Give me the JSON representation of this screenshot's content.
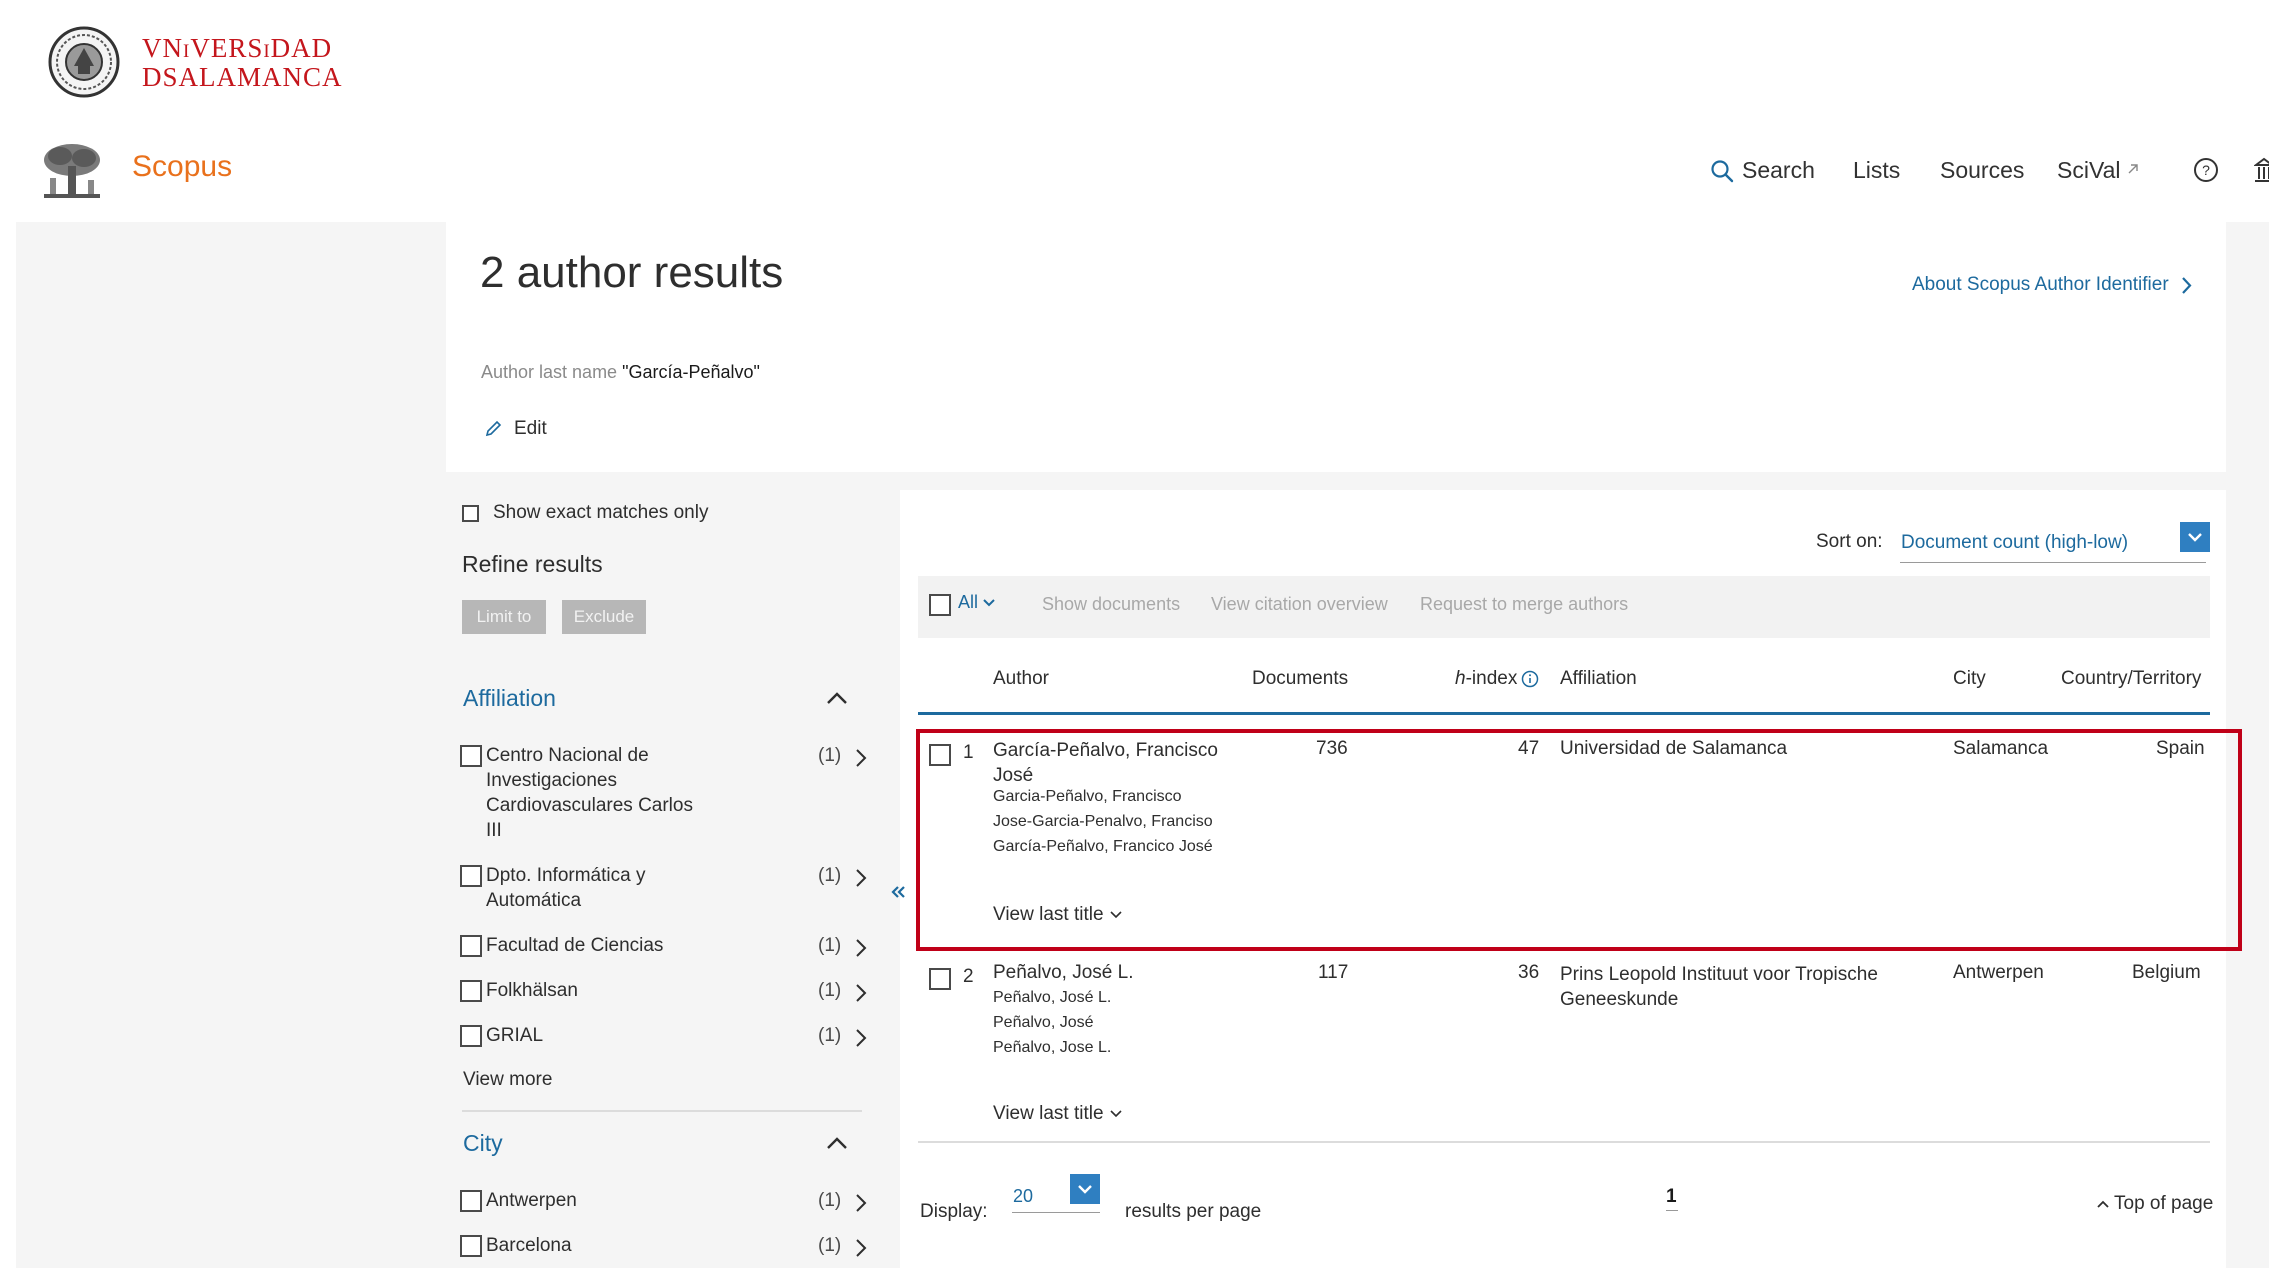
{
  "university": {
    "line1": "VNiVERSiDAD",
    "line2": "DSALAMANCA"
  },
  "app": {
    "name": "Scopus"
  },
  "nav": {
    "search": "Search",
    "lists": "Lists",
    "sources": "Sources",
    "scival": "SciVal"
  },
  "summary": {
    "title": "2 author results",
    "about_link": "About Scopus Author Identifier",
    "query_label": "Author last name",
    "query_value": "\"García-Peñalvo\"",
    "edit": "Edit"
  },
  "refine": {
    "exact_matches": "Show exact matches only",
    "title": "Refine results",
    "limit_to": "Limit to",
    "exclude": "Exclude",
    "affiliation": {
      "heading": "Affiliation",
      "items": [
        {
          "label": "Centro Nacional de Investigaciones Cardiovasculares Carlos III",
          "count": "(1)"
        },
        {
          "label": "Dpto. Informática y Automática",
          "count": "(1)"
        },
        {
          "label": "Facultad de Ciencias",
          "count": "(1)"
        },
        {
          "label": "Folkhälsan",
          "count": "(1)"
        },
        {
          "label": "GRIAL",
          "count": "(1)"
        }
      ],
      "view_more": "View more"
    },
    "city": {
      "heading": "City",
      "items": [
        {
          "label": "Antwerpen",
          "count": "(1)"
        },
        {
          "label": "Barcelona",
          "count": "(1)"
        }
      ]
    }
  },
  "sort": {
    "label": "Sort on:",
    "value": "Document count (high-low)"
  },
  "toolbar": {
    "all": "All",
    "show_documents": "Show documents",
    "view_citation": "View citation overview",
    "merge": "Request to merge authors"
  },
  "columns": {
    "author": "Author",
    "documents": "Documents",
    "h_prefix": "h",
    "h_suffix": "-index",
    "affiliation": "Affiliation",
    "city": "City",
    "country": "Country/Territory"
  },
  "results": [
    {
      "num": "1",
      "name_line1": "García-Peñalvo, Francisco",
      "name_line2": "José",
      "variants": [
        "Garcia-Peñalvo, Francisco",
        "Jose-Garcia-Penalvo, Franciso",
        "García-Peñalvo, Francico José"
      ],
      "documents": "736",
      "h_index": "47",
      "affiliation_line1": "Universidad de Salamanca",
      "affiliation_line2": "",
      "city": "Salamanca",
      "country": "Spain",
      "view_last": "View last title"
    },
    {
      "num": "2",
      "name_line1": "Peñalvo, José L.",
      "name_line2": "",
      "variants": [
        "Peñalvo, José L.",
        "Peñalvo, José",
        "Peñalvo, Jose L."
      ],
      "documents": "117",
      "h_index": "36",
      "affiliation_line1": "Prins Leopold Instituut voor Tropische",
      "affiliation_line2": "Geneeskunde",
      "city": "Antwerpen",
      "country": "Belgium",
      "view_last": "View last title"
    }
  ],
  "pagination": {
    "display_label": "Display:",
    "per_page": "20",
    "results_per_page": "results per page",
    "page": "1",
    "top_of_page": "Top of page"
  },
  "colors": {
    "accent": "#1d6a9e",
    "brand_orange": "#e9711c",
    "university_red": "#c4161c",
    "highlight": "#c00018"
  }
}
